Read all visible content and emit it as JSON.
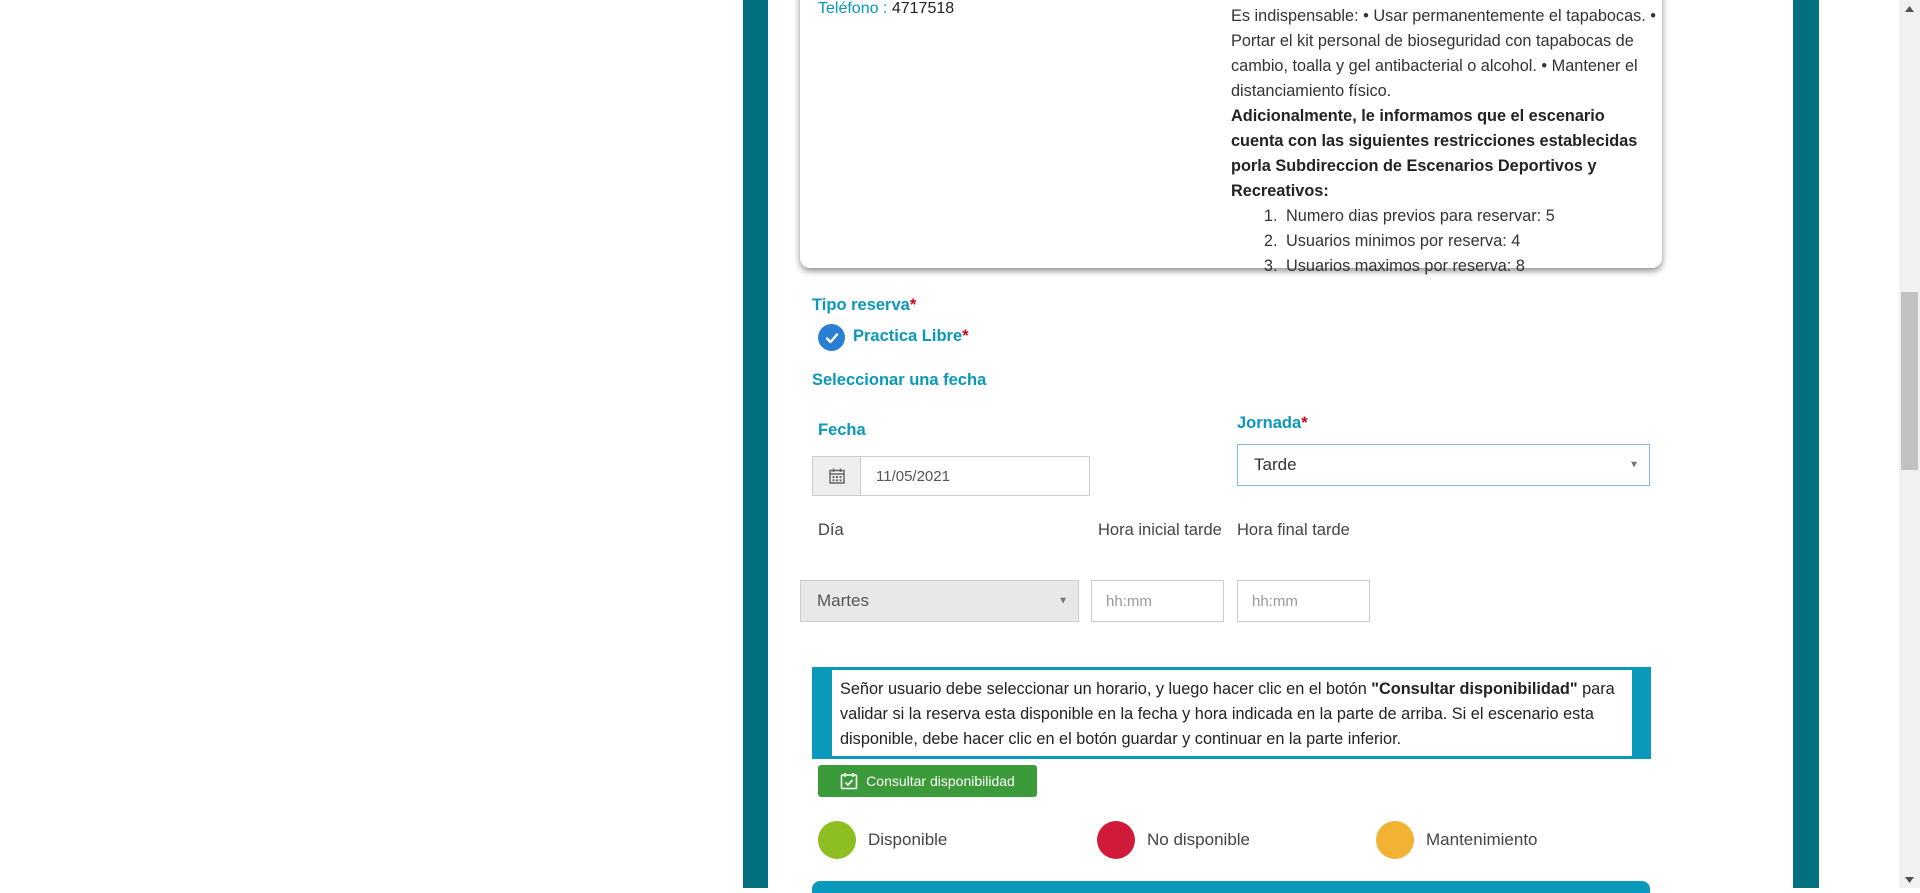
{
  "contact": {
    "phone_label": "Teléfono :",
    "phone_value": "4717518"
  },
  "notes": {
    "partial_top": "Es indispensable: • Usar permanentemente el tapabocas. • Portar el kit personal de bioseguridad con tapabocas de cambio, toalla y gel antibacterial o alcohol. • Mantener el distanciamiento físico.",
    "restrictions_heading": "Adicionalmente, le informamos que el escenario cuenta con las siguientes restricciones establecidas porla Subdireccion de Escenarios Deportivos y Recreativos:",
    "restrictions": [
      "Numero dias previos para reservar: 5",
      "Usuarios minimos por reserva: 4",
      "Usuarios maximos por reserva: 8"
    ]
  },
  "reservation": {
    "type_label": "Tipo reserva",
    "required_mark": "*",
    "type_option": "Practica Libre",
    "select_date_title": "Seleccionar una fecha",
    "fecha_label": "Fecha",
    "fecha_value": "11/05/2021",
    "jornada_label": "Jornada",
    "jornada_value": "Tarde",
    "dia_label": "Día",
    "dia_value": "Martes",
    "hora_inicial_label": "Hora inicial tarde",
    "hora_final_label": "Hora final tarde",
    "time_placeholder": "hh:mm"
  },
  "notice": {
    "text_before": "Señor usuario debe seleccionar un horario, y luego hacer clic en el botón ",
    "text_bold": "\"Consultar disponibilidad\"",
    "text_after": " para validar si la reserva esta disponible en la fecha y hora indicada en la parte de arriba. Si el escenario esta disponible, debe hacer clic en el botón guardar y continuar en la parte inferior."
  },
  "actions": {
    "consult_label": "Consultar disponibilidad"
  },
  "legend": [
    {
      "label": "Disponible",
      "color": "#8dbf22"
    },
    {
      "label": "No disponible",
      "color": "#d11a3a"
    },
    {
      "label": "Mantenimiento",
      "color": "#f2b233"
    }
  ],
  "colors": {
    "frame": "#03707f",
    "accent": "#0a98bb",
    "button": "#3b9a3a"
  },
  "icons": {
    "date_addon": "calendar-icon",
    "type_check": "check-circle-icon",
    "consult_button": "calendar-check-icon"
  }
}
